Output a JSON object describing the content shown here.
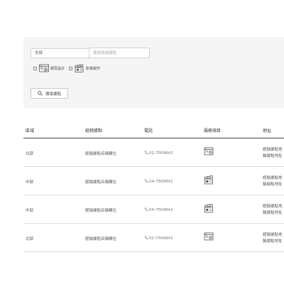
{
  "filter": {
    "region_select": {
      "value": "全部"
    },
    "keyword_placeholder": "搜尋經銷據點",
    "checkboxes": [
      {
        "label": "網頁設計",
        "icon": "web-design-icon"
      },
      {
        "label": "影像製作",
        "icon": "clapperboard-icon"
      }
    ],
    "search_button_label": "搜尋據點"
  },
  "table": {
    "headers": {
      "region": "區域",
      "name": "經銷據點",
      "phone": "電話",
      "service": "服務項目",
      "address": "地址"
    },
    "rows": [
      {
        "region": "北部",
        "name": "經銷據點名稱欄位",
        "phone": "02-7569842",
        "service": "web-design-icon",
        "address": [
          "經銷據點地",
          "銷據點地址"
        ]
      },
      {
        "region": "中部",
        "name": "經銷據點名稱欄位",
        "phone": "04-7569842",
        "service": "clapperboard-icon",
        "address": [
          "經銷據點地",
          "銷據點地址"
        ]
      },
      {
        "region": "中部",
        "name": "經銷據點名稱欄位",
        "phone": "04-7569842",
        "service": "clapperboard-icon",
        "address": [
          "經銷據點地",
          "銷據點地址"
        ]
      },
      {
        "region": "北部",
        "name": "經銷據點名稱欄位",
        "phone": "02-7569842",
        "service": "web-design-icon",
        "address": [
          "經銷據點地",
          "銷據點地址"
        ]
      }
    ]
  }
}
